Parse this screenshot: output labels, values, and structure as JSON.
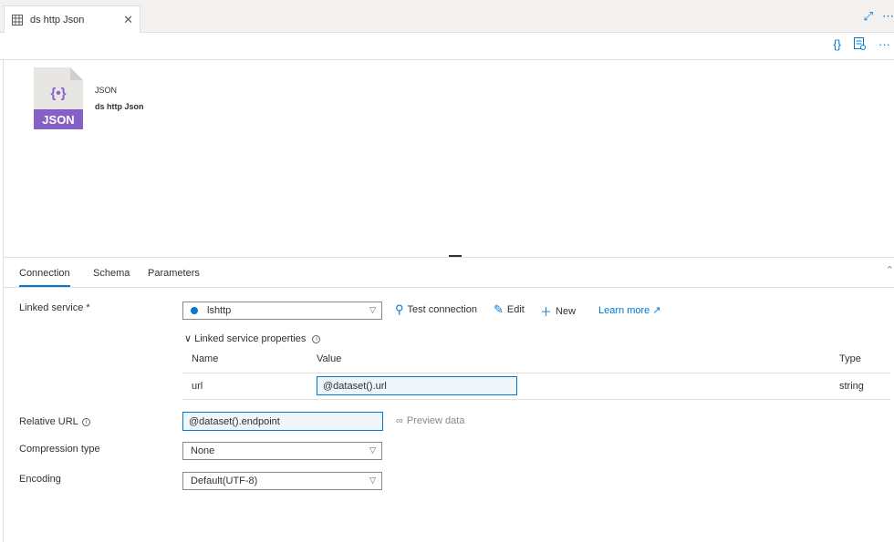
{
  "tab": {
    "title": "ds http Json",
    "close": "✕"
  },
  "strip_icons": [
    "expand-icon",
    "more-icon"
  ],
  "toolbar": {
    "code_glyph": "{}",
    "more_glyph": "···"
  },
  "dataset": {
    "type_label": "JSON",
    "name": "ds http Json",
    "icon_text": "JSON",
    "icon_glyph": "{•}"
  },
  "tabs": [
    "Connection",
    "Schema",
    "Parameters"
  ],
  "form": {
    "linked_service_label": "Linked service *",
    "linked_service_value": "lshttp",
    "test_connection": "Test connection",
    "edit": "Edit",
    "new": "New",
    "learn_more": "Learn more",
    "lsp_toggle": "Linked service properties",
    "col_name": "Name",
    "col_value": "Value",
    "col_type": "Type",
    "row_name": "url",
    "row_value": "@dataset().url",
    "row_type": "string",
    "relative_url_label": "Relative URL",
    "relative_url_value": "@dataset().endpoint",
    "preview_data": "Preview data",
    "compression_label": "Compression type",
    "compression_value": "None",
    "encoding_label": "Encoding",
    "encoding_value": "Default(UTF-8)"
  },
  "colors": {
    "accent": "#0078d4",
    "json_icon": "#8661c5",
    "icon_bg": "#e8e6e3"
  }
}
